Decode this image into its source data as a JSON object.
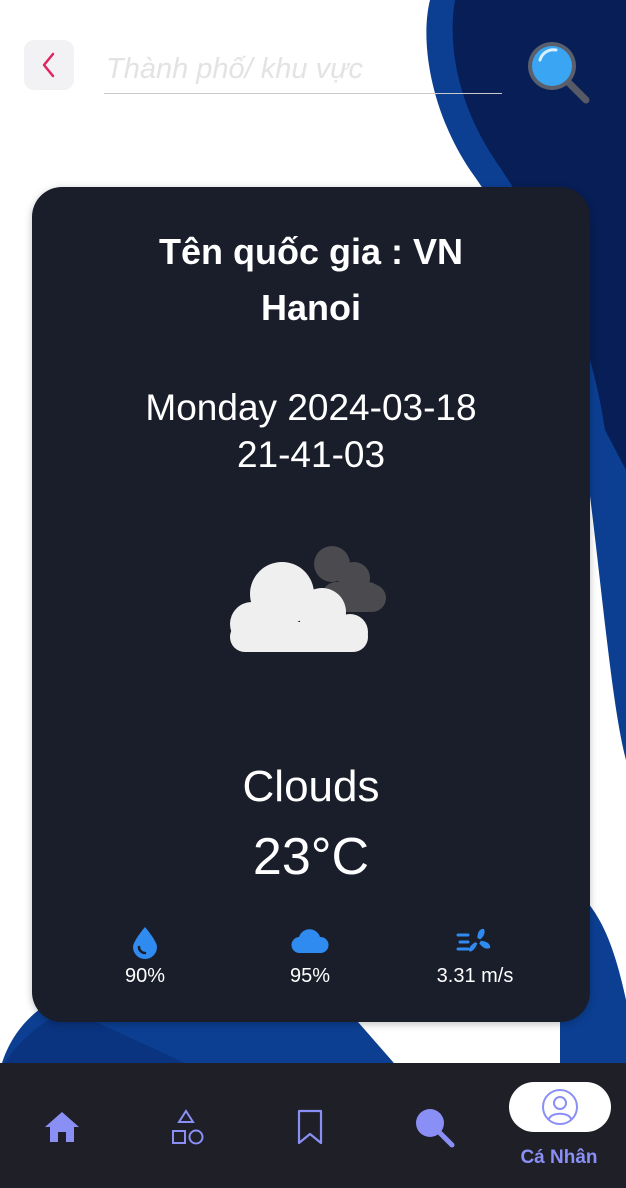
{
  "search": {
    "placeholder": "Thành phố/ khu vực",
    "back_icon": "chevron-left-icon",
    "search_icon": "magnifier-icon"
  },
  "weather": {
    "country_line": "Tên quốc gia : VN",
    "city": "Hanoi",
    "date": "Monday 2024-03-18",
    "time": "21-41-03",
    "condition_icon": "cloud-icon",
    "description": "Clouds",
    "temperature": "23°C",
    "stats": {
      "humidity": {
        "icon": "water-drop-icon",
        "value": "90%"
      },
      "cloudiness": {
        "icon": "cloud-icon",
        "value": "95%"
      },
      "wind": {
        "icon": "wind-fan-icon",
        "value": "3.31 m/s"
      }
    }
  },
  "nav": {
    "items": [
      {
        "icon": "home-icon"
      },
      {
        "icon": "shapes-icon"
      },
      {
        "icon": "bookmark-icon"
      },
      {
        "icon": "search-icon"
      },
      {
        "icon": "user-icon",
        "label": "Cá Nhân"
      }
    ]
  },
  "colors": {
    "card_bg": "#1a1d2a",
    "nav_bg": "#1f1f27",
    "accent": "#8a8ff5",
    "stat_icon": "#2f8bef",
    "wave_blue": "#0c3f92",
    "back_chevron": "#e0245e"
  }
}
